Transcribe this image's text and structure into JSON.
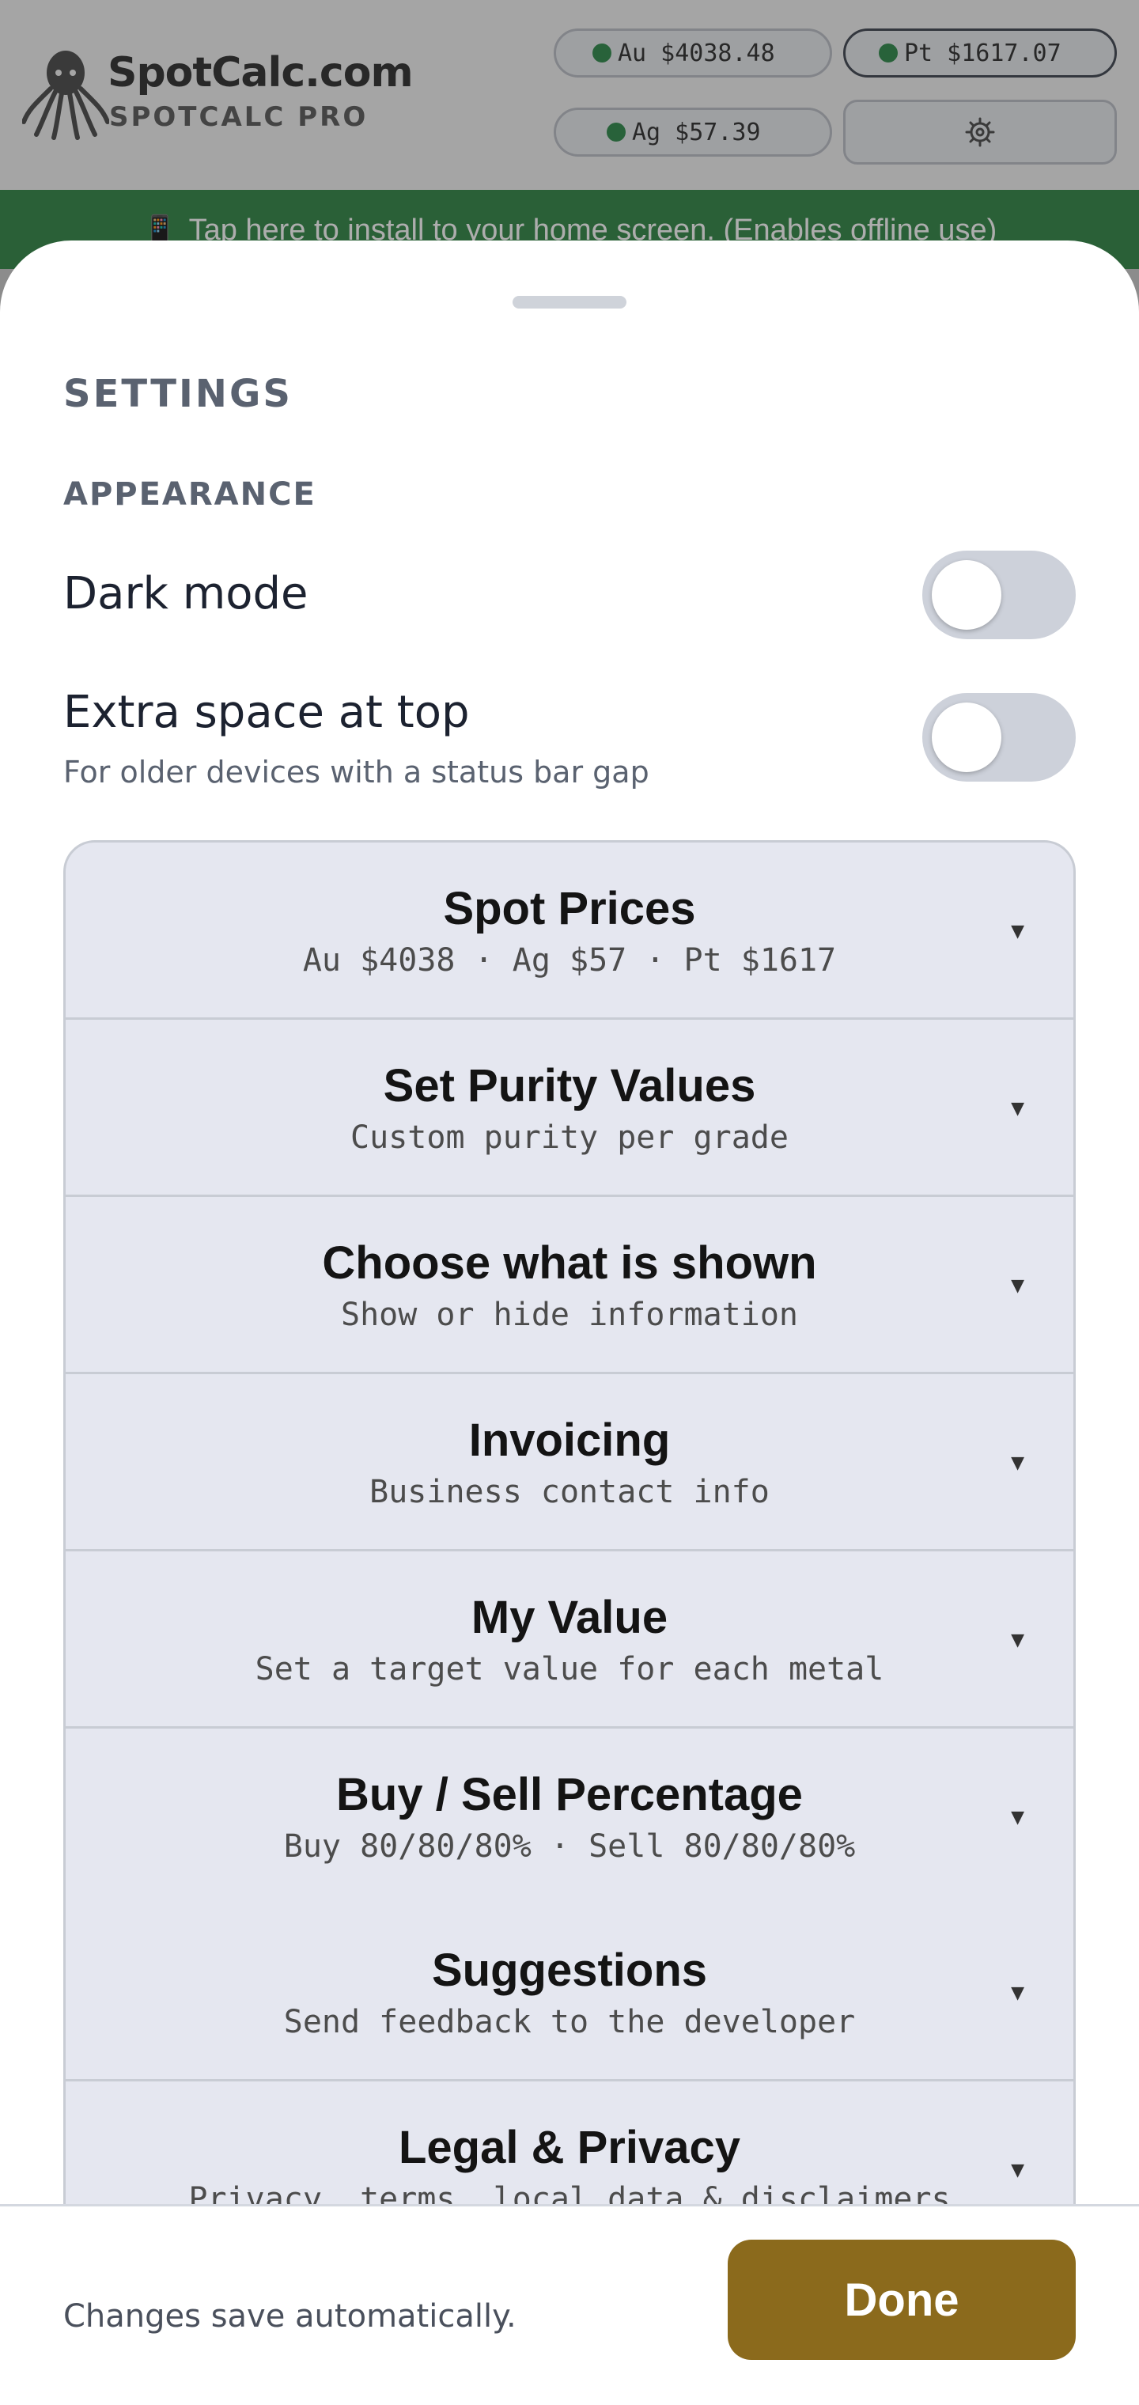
{
  "header": {
    "brand_name": "SpotCalc.com",
    "brand_sub": "SPOTCALC PRO",
    "logo_icon": "octopus-logo",
    "prices": {
      "au": "Au $4038.48",
      "pt": "Pt $1617.07",
      "ag": "Ag $57.39"
    },
    "status_color": "#1b7f3a",
    "settings_icon": "gear-icon"
  },
  "install_banner": {
    "icon": "phone-icon",
    "text": "Tap here to install to your home screen. (Enables offline use)"
  },
  "sheet": {
    "title": "SETTINGS",
    "appearance_label": "APPEARANCE",
    "dark_mode": {
      "label": "Dark mode",
      "enabled": false
    },
    "extra_space": {
      "label": "Extra space at top",
      "description": "For older devices with a status bar gap",
      "enabled": false
    },
    "sections": [
      {
        "title": "Spot Prices",
        "subtitle": "Au $4038 · Ag $57 · Pt $1617"
      },
      {
        "title": "Set Purity Values",
        "subtitle": "Custom purity per grade"
      },
      {
        "title": "Choose what is shown",
        "subtitle": "Show or hide information"
      },
      {
        "title": "Invoicing",
        "subtitle": "Business contact info"
      },
      {
        "title": "My Value",
        "subtitle": "Set a target value for each metal"
      },
      {
        "title": "Buy / Sell Percentage",
        "subtitle": "Buy 80/80/80% · Sell 80/80/80%"
      },
      {
        "title": "Suggestions",
        "subtitle": "Send feedback to the developer"
      },
      {
        "title": "Legal & Privacy",
        "subtitle": "Privacy, terms, local data & disclaimers"
      }
    ],
    "expand_icon": "caret-down-icon"
  },
  "footer": {
    "note": "Changes save automatically.",
    "done_label": "Done",
    "accent_color": "#8b6a1c"
  }
}
